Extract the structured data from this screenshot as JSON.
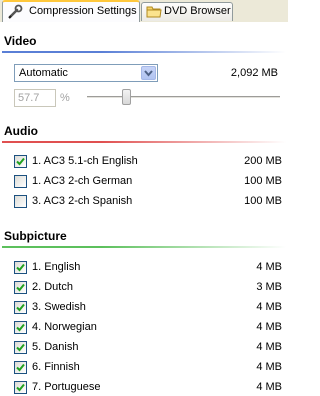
{
  "tabs": [
    {
      "label": "Compression Settings",
      "icon": "wrench-icon"
    },
    {
      "label": "DVD Browser",
      "icon": "folder-icon"
    }
  ],
  "video": {
    "heading": "Video",
    "mode_select": "Automatic",
    "size": "2,092 MB",
    "quality_value": "57.7",
    "quality_unit": "%",
    "slider_fraction": 0.19
  },
  "audio": {
    "heading": "Audio",
    "tracks": [
      {
        "label": "1. AC3 5.1-ch English",
        "size": "200 MB",
        "checked": true
      },
      {
        "label": "1. AC3 2-ch German",
        "size": "100 MB",
        "checked": false
      },
      {
        "label": "3. AC3 2-ch Spanish",
        "size": "100 MB",
        "checked": false
      }
    ]
  },
  "subpicture": {
    "heading": "Subpicture",
    "tracks": [
      {
        "label": "1. English",
        "size": "4 MB",
        "checked": true
      },
      {
        "label": "2. Dutch",
        "size": "3 MB",
        "checked": true
      },
      {
        "label": "3. Swedish",
        "size": "4 MB",
        "checked": true
      },
      {
        "label": "4. Norwegian",
        "size": "4 MB",
        "checked": true
      },
      {
        "label": "5. Danish",
        "size": "4 MB",
        "checked": true
      },
      {
        "label": "6. Finnish",
        "size": "4 MB",
        "checked": true
      },
      {
        "label": "7. Portuguese",
        "size": "4 MB",
        "checked": true
      }
    ]
  },
  "colors": {
    "video_rule": "#5a7fd6",
    "audio_rule": "#e05050",
    "subpicture_rule": "#5cc05c"
  }
}
